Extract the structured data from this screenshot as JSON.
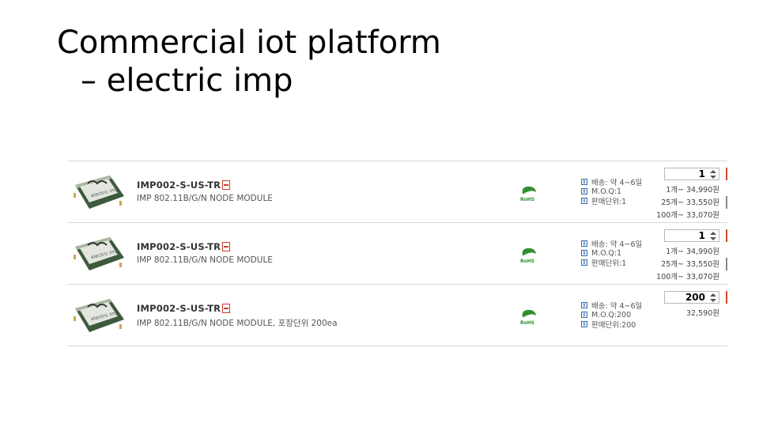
{
  "title": {
    "line1": "Commercial iot platform",
    "line2": "– electric imp"
  },
  "colors": {
    "accent": "#d44a2a",
    "rohs_green": "#2f8f2f",
    "info_blue": "#3a6ea5"
  },
  "products": [
    {
      "name": "IMP002-S-US-TR",
      "description": "IMP 802.11B/G/N NODE MODULE",
      "info": [
        "배송: 약 4~6일",
        "M.O.Q:1",
        "판매단위:1"
      ],
      "quantity": "1",
      "prices": [
        "1개~ 34,990원",
        "25개~ 33,550원",
        "100개~ 33,070원"
      ]
    },
    {
      "name": "IMP002-S-US-TR",
      "description": "IMP 802.11B/G/N NODE MODULE",
      "info": [
        "배송: 약 4~6일",
        "M.O.Q:1",
        "판매단위:1"
      ],
      "quantity": "1",
      "prices": [
        "1개~ 34,990원",
        "25개~ 33,550원",
        "100개~ 33,070원"
      ]
    },
    {
      "name": "IMP002-S-US-TR",
      "description": "IMP 802.11B/G/N NODE MODULE, 포장단위 200ea",
      "info": [
        "배송: 약 4~6일",
        "M.O.Q:200",
        "판매단위:200"
      ],
      "quantity": "200",
      "prices": [
        "32,590원"
      ]
    }
  ]
}
